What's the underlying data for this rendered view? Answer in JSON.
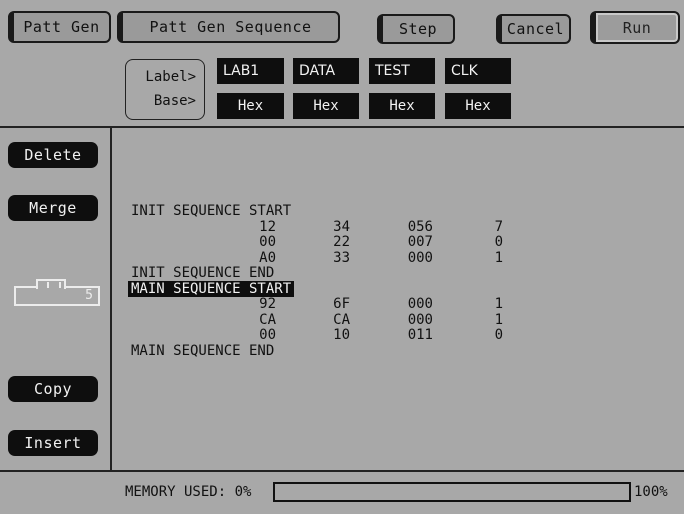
{
  "header": {
    "patt_gen": "Patt Gen",
    "title": "Patt Gen Sequence",
    "step": "Step",
    "cancel": "Cancel",
    "run": "Run"
  },
  "labels": {
    "label_prompt": "Label>",
    "base_prompt": "Base>",
    "columns": [
      {
        "label": "LAB1",
        "base": "Hex"
      },
      {
        "label": "DATA",
        "base": "Hex"
      },
      {
        "label": "TEST",
        "base": "Hex"
      },
      {
        "label": "CLK",
        "base": "Hex"
      }
    ]
  },
  "sidebar": {
    "delete": "Delete",
    "merge": "Merge",
    "copy": "Copy",
    "insert": "Insert",
    "slider_value": "5"
  },
  "sequence": {
    "init_start": "INIT SEQUENCE START",
    "init_rows": [
      [
        "12",
        "34",
        "056",
        "7"
      ],
      [
        "00",
        "22",
        "007",
        "0"
      ],
      [
        "A0",
        "33",
        "000",
        "1"
      ]
    ],
    "init_end": "INIT SEQUENCE END",
    "main_start": "MAIN SEQUENCE START",
    "main_rows": [
      [
        "92",
        "6F",
        "000",
        "1"
      ],
      [
        "CA",
        "CA",
        "000",
        "1"
      ],
      [
        "00",
        "10",
        "011",
        "0"
      ]
    ],
    "main_end": "MAIN SEQUENCE END"
  },
  "memory": {
    "label": "MEMORY USED: 0%",
    "used_fraction": 0,
    "max_label": "100%"
  },
  "colors": {
    "background": "#a8a8a8",
    "field": "#0e0e0e",
    "text": "#111111"
  }
}
